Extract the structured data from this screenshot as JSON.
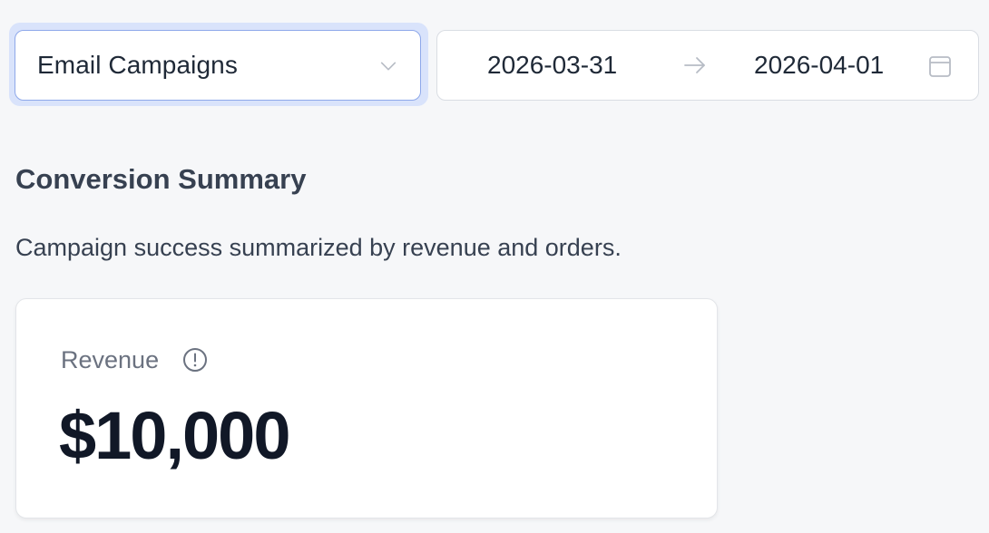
{
  "campaign_select": {
    "selected": "Email Campaigns",
    "icon": "chevron-down-icon"
  },
  "date_range": {
    "start": "2026-03-31",
    "end": "2026-04-01",
    "separator_icon": "arrow-right-icon",
    "calendar_icon": "calendar-icon"
  },
  "section": {
    "title": "Conversion Summary",
    "description": "Campaign success summarized by revenue and orders."
  },
  "metric_card": {
    "label": "Revenue",
    "value": "$10,000",
    "info_icon": "info-icon"
  },
  "colors": {
    "select_border": "#8ea8ea",
    "select_focus_ring": "#d9e3fb",
    "background": "#f6f7f9",
    "value_text": "#111827"
  }
}
